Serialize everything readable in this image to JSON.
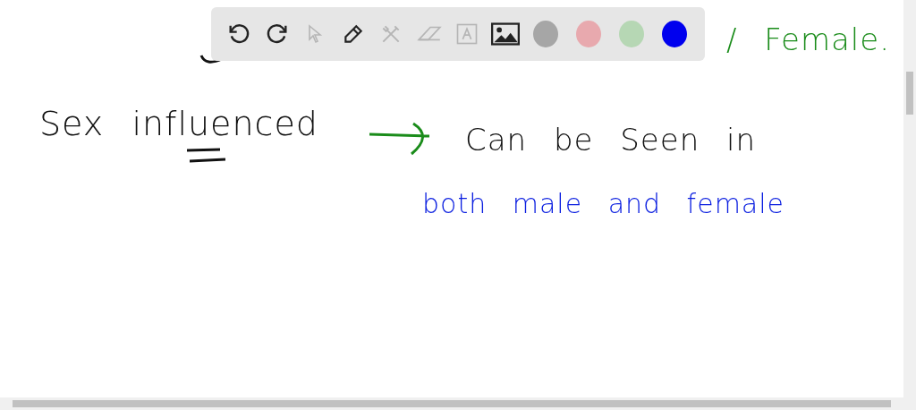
{
  "toolbar": {
    "tools": [
      {
        "kind": "undo",
        "disabled": false
      },
      {
        "kind": "redo",
        "disabled": false
      },
      {
        "kind": "pointer",
        "disabled": true
      },
      {
        "kind": "pen",
        "disabled": false
      },
      {
        "kind": "tools",
        "disabled": true
      },
      {
        "kind": "eraser",
        "disabled": true
      },
      {
        "kind": "text",
        "disabled": true
      },
      {
        "kind": "image",
        "disabled": false
      }
    ],
    "colors": [
      {
        "color": "#a6a6a6"
      },
      {
        "color": "#e8a9ae"
      },
      {
        "color": "#b6d7b4"
      },
      {
        "color": "#0000ee"
      }
    ]
  },
  "canvas": {
    "notes": [
      {
        "text": "/ Female.",
        "color": "#1a8c1a"
      },
      {
        "text": "Sex influenced",
        "color": "#111111"
      },
      {
        "text": "Can be Seen in",
        "color": "#111111"
      },
      {
        "text": "both male and female",
        "color": "#0a1ee0"
      }
    ]
  }
}
